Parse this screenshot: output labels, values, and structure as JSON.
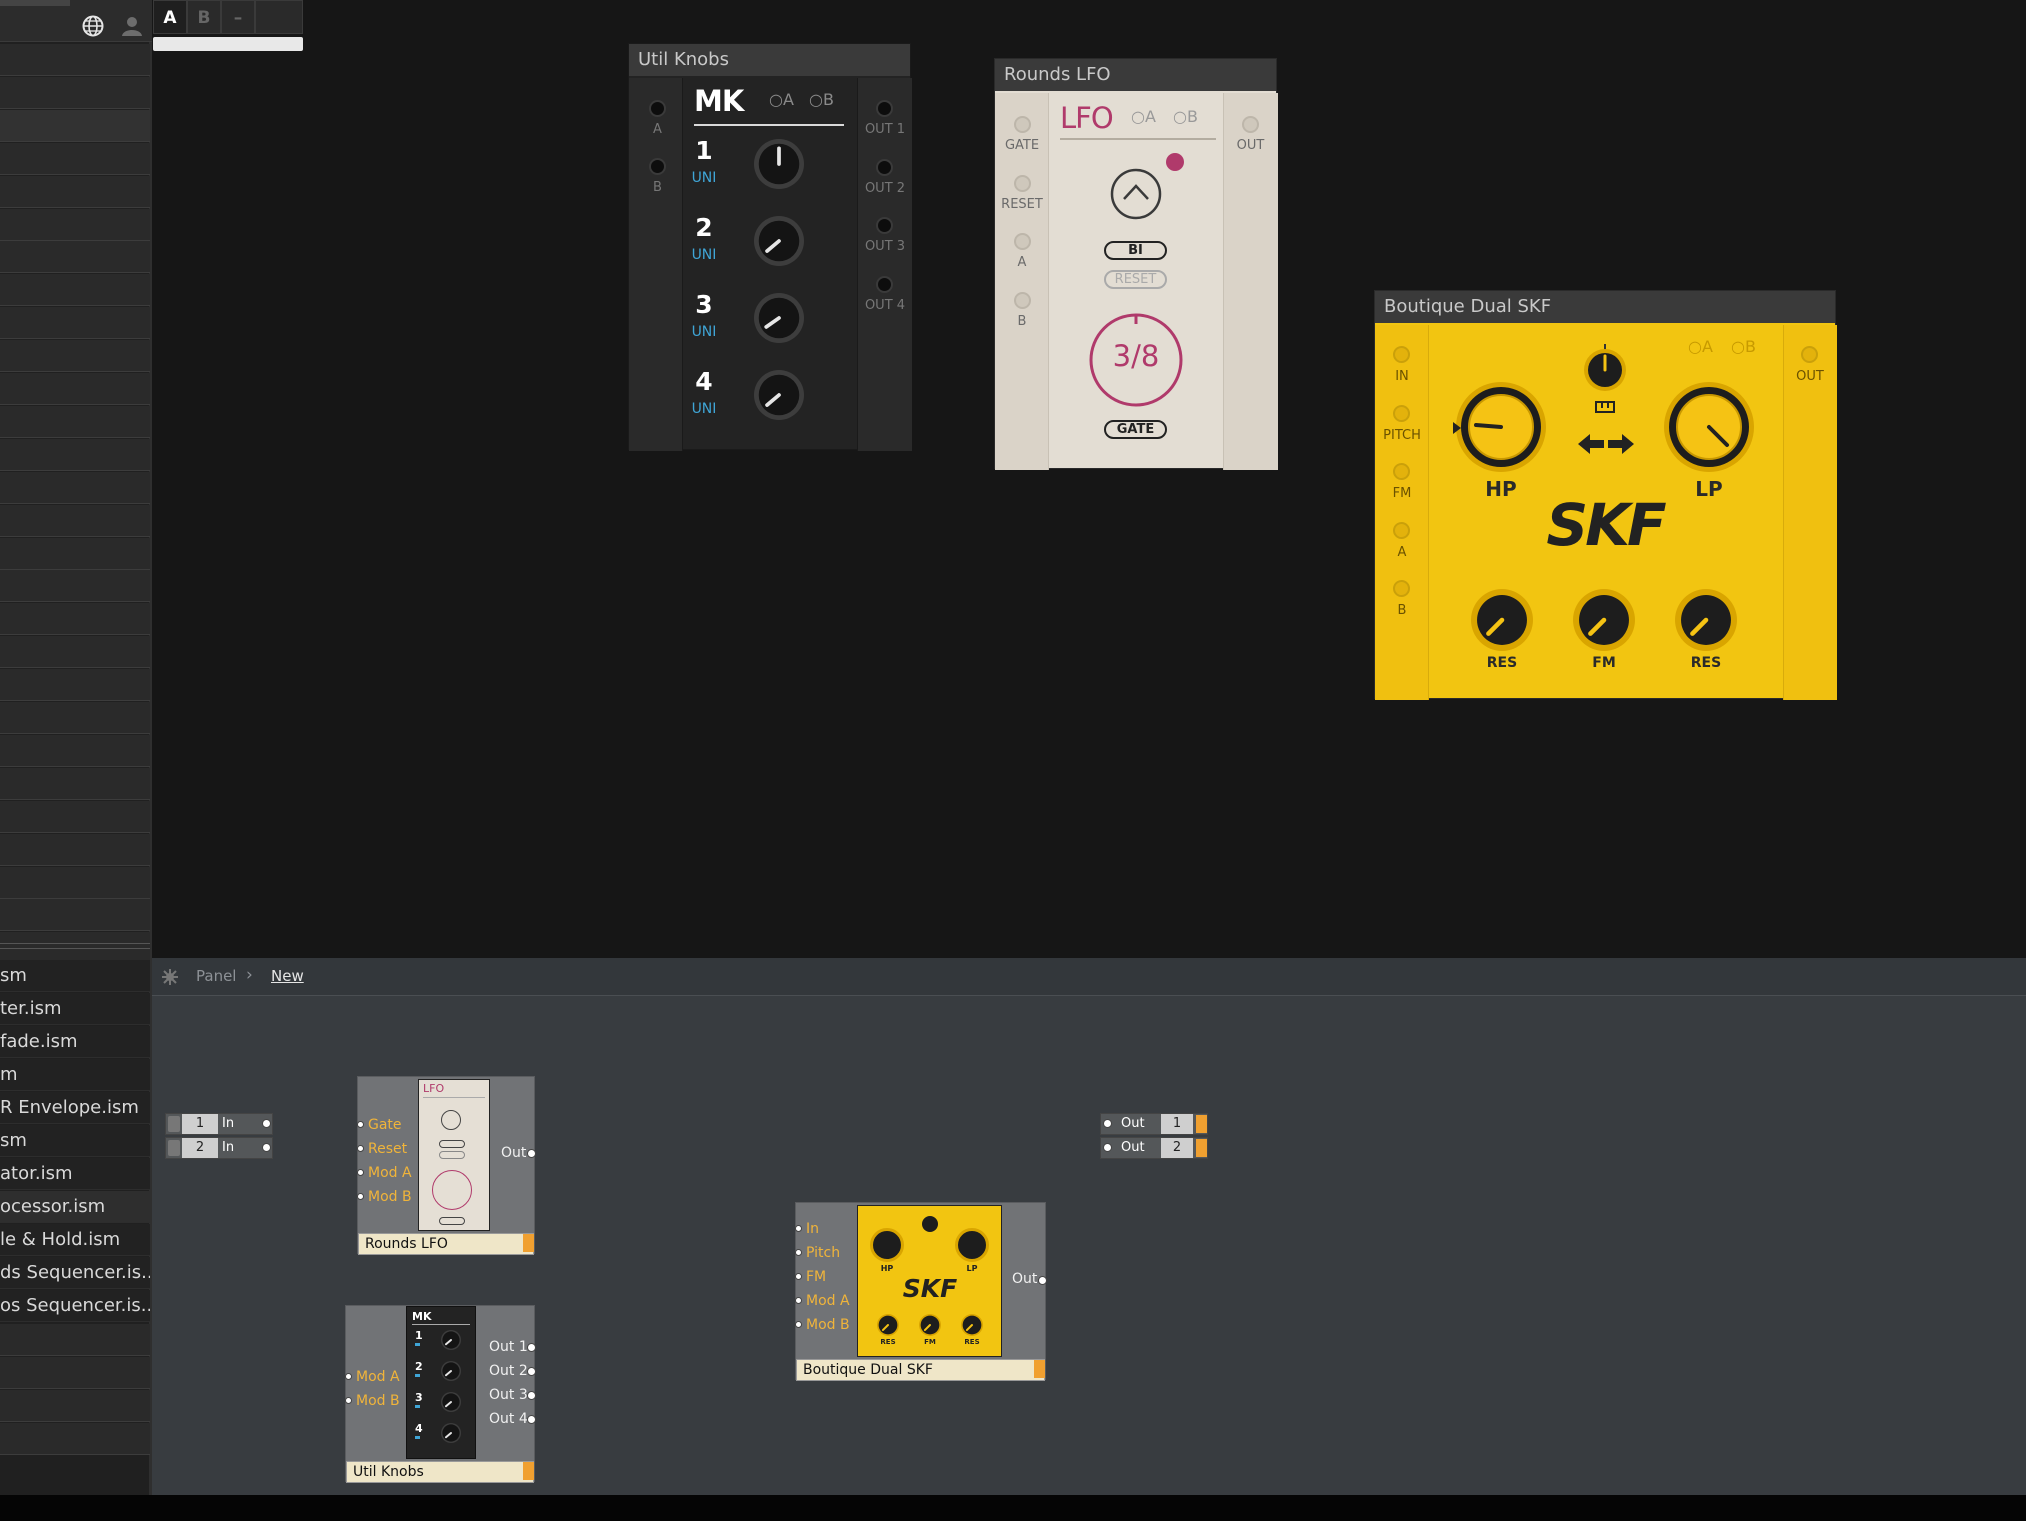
{
  "top_tabs": [
    {
      "label": "A",
      "active": true
    },
    {
      "label": "B",
      "active": false
    },
    {
      "label": "–",
      "active": false
    }
  ],
  "sidebar": {
    "icons": [
      "globe-icon",
      "user-icon"
    ],
    "files": [
      {
        "label": "sm"
      },
      {
        "label": "ter.ism"
      },
      {
        "label": "fade.ism"
      },
      {
        "label": "m"
      },
      {
        "label": "R Envelope.ism"
      },
      {
        "label": "sm"
      },
      {
        "label": "ator.ism"
      },
      {
        "label": "ocessor.ism",
        "selected": true
      },
      {
        "label": "le & Hold.ism"
      },
      {
        "label": "ds Sequencer.is..."
      },
      {
        "label": "os Sequencer.is..."
      }
    ]
  },
  "util_knobs": {
    "title": "Util Knobs",
    "logo": "MK",
    "mode_a": "A",
    "mode_b": "B",
    "inputs": [
      "A",
      "B"
    ],
    "knobs": [
      {
        "num": "1",
        "mode": "UNI"
      },
      {
        "num": "2",
        "mode": "UNI"
      },
      {
        "num": "3",
        "mode": "UNI"
      },
      {
        "num": "4",
        "mode": "UNI"
      }
    ],
    "outputs": [
      "OUT 1",
      "OUT 2",
      "OUT 3",
      "OUT 4"
    ]
  },
  "rounds_lfo": {
    "title": "Rounds LFO",
    "logo": "LFO",
    "mode_a": "A",
    "mode_b": "B",
    "inputs": [
      "GATE",
      "RESET",
      "A",
      "B"
    ],
    "output": "OUT",
    "bi_button": "BI",
    "reset_button": "RESET",
    "rate": "3/8",
    "gate_button": "GATE",
    "accent": "#b03a6b"
  },
  "skf": {
    "title": "Boutique Dual SKF",
    "logo": "SKF",
    "mode_a": "A",
    "mode_b": "B",
    "inputs": [
      "IN",
      "PITCH",
      "FM",
      "A",
      "B"
    ],
    "output": "OUT",
    "big_knobs": [
      "HP",
      "LP"
    ],
    "small_knobs": [
      "RES",
      "FM",
      "RES"
    ],
    "accent": "#f2c511"
  },
  "breadcrumb": {
    "root": "Panel",
    "current": "New"
  },
  "inputs_block": [
    {
      "num": "1",
      "label": "In"
    },
    {
      "num": "2",
      "label": "In"
    }
  ],
  "outputs_block": [
    {
      "label": "Out",
      "num": "1"
    },
    {
      "label": "Out",
      "num": "2"
    }
  ],
  "blocks": {
    "lfo": {
      "name": "Rounds LFO",
      "ports_in": [
        "Gate",
        "Reset",
        "Mod A",
        "Mod B"
      ],
      "port_out": "Out",
      "thumb_logo": "LFO"
    },
    "util": {
      "name": "Util Knobs",
      "ports_in": [
        "Mod A",
        "Mod B"
      ],
      "ports_out": [
        "Out 1",
        "Out 2",
        "Out 3",
        "Out 4"
      ],
      "thumb_logo": "MK",
      "thumb_nums": [
        "1",
        "2",
        "3",
        "4"
      ]
    },
    "skf": {
      "name": "Boutique Dual SKF",
      "ports_in": [
        "In",
        "Pitch",
        "FM",
        "Mod A",
        "Mod B"
      ],
      "port_out": "Out",
      "thumb_logo": "SKF",
      "thumb_big": [
        "HP",
        "LP"
      ],
      "thumb_small": [
        "RES",
        "FM",
        "RES"
      ]
    }
  }
}
